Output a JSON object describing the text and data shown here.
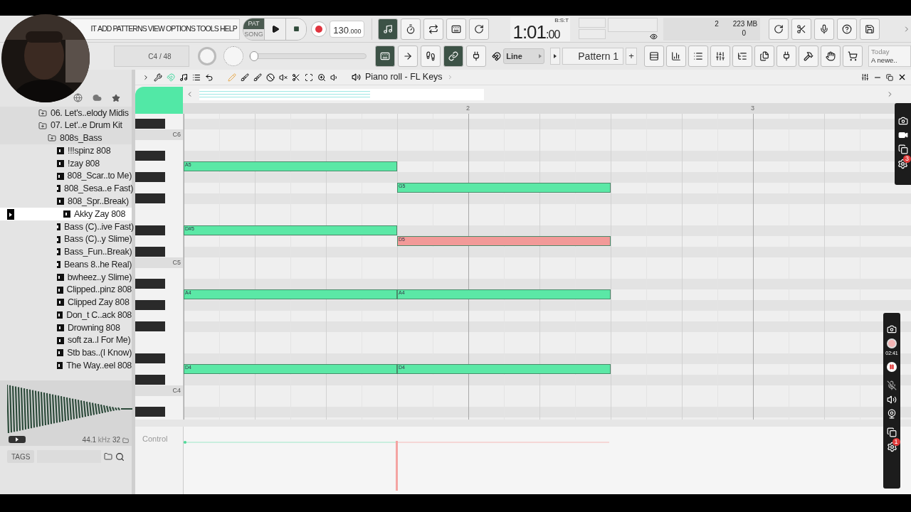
{
  "menu": [
    "IT",
    "ADD",
    "PATTERNS",
    "VIEW",
    "OPTIONS",
    "TOOLS",
    "HELP"
  ],
  "transport": {
    "modes": [
      {
        "label": "PAT",
        "selected": true
      },
      {
        "label": "SONG",
        "selected": false
      }
    ],
    "tempo": "130",
    "tempo_fraction": ".000"
  },
  "time": {
    "main": "1:01",
    "sub": ":00",
    "format": "B:S:T"
  },
  "cpu": {
    "voices": "2",
    "memory": "223 MB",
    "polyphony": "0"
  },
  "hint": "C4 / 48",
  "main_slider": {
    "level": 0
  },
  "snap": "Line",
  "pattern": "Pattern 1",
  "add_pattern": "+",
  "news": {
    "line1": "Today",
    "line2": "A newe.."
  },
  "browser": {
    "tree": [
      {
        "label": "06. Let's..elody Midis",
        "kind": "folder",
        "selected": false
      },
      {
        "label": "07. Let'..e Drum Kit",
        "kind": "folder",
        "selected": false,
        "children": [
          {
            "label": "808s_Bass",
            "kind": "folder",
            "selected": false,
            "children": [
              {
                "label": "!!!spinz 808",
                "kind": "file",
                "selected": false
              },
              {
                "label": "!zay 808",
                "kind": "file",
                "selected": false
              },
              {
                "label": "808_Scar..to Me)",
                "kind": "file",
                "selected": false
              },
              {
                "label": "808_Sesa..e Fast)",
                "kind": "file",
                "selected": false
              },
              {
                "label": "808_Spr..Break)",
                "kind": "file",
                "selected": false
              },
              {
                "label": "Akky Zay 808",
                "kind": "file",
                "selected": true
              },
              {
                "label": "Bass (C)..ive Fast)",
                "kind": "file",
                "selected": false
              },
              {
                "label": "Bass (C)..y Slime)",
                "kind": "file",
                "selected": false
              },
              {
                "label": "Bass_Fun..Break)",
                "kind": "file",
                "selected": false
              },
              {
                "label": "Beans 8..he Real)",
                "kind": "file",
                "selected": false
              },
              {
                "label": "bwheez..y Slime)",
                "kind": "file",
                "selected": false
              },
              {
                "label": "Clipped..pinz 808",
                "kind": "file",
                "selected": false
              },
              {
                "label": "Clipped Zay 808",
                "kind": "file",
                "selected": false
              },
              {
                "label": "Don_t C..ack 808",
                "kind": "file",
                "selected": false
              },
              {
                "label": "Drowning 808",
                "kind": "file",
                "selected": false
              },
              {
                "label": "soft za..l For Me)",
                "kind": "file",
                "selected": false
              },
              {
                "label": "Stb bas..(I Know)",
                "kind": "file",
                "selected": false
              },
              {
                "label": "The Way..eel 808",
                "kind": "file",
                "selected": false
              }
            ]
          }
        ]
      }
    ],
    "sample_rate": "44.1",
    "sample_unit": "kHz",
    "bit_depth": "32",
    "tags_label": "TAGS"
  },
  "piano_roll": {
    "title": "Piano roll - FL Keys",
    "ruler": [
      "2",
      "3"
    ],
    "key_labels": [
      "C6",
      "C5",
      "C4"
    ],
    "note_columns": [
      {
        "notes": [
          {
            "label": "A5",
            "color": "#5be8a6"
          },
          {
            "label": "D#5",
            "color": "#5be8a6"
          },
          {
            "label": "A4",
            "color": "#5be8a6"
          },
          {
            "label": "D4",
            "color": "#5be8a6"
          }
        ]
      },
      {
        "notes": [
          {
            "label": "G5",
            "color": "#5be8a6"
          },
          {
            "label": "D5",
            "color": "#f29a98"
          },
          {
            "label": "A4",
            "color": "#5be8a6"
          },
          {
            "label": "D4",
            "color": "#5be8a6"
          }
        ]
      }
    ],
    "control_label": "Control"
  },
  "recorder": {
    "timer": "02:41",
    "top_badge": "3",
    "bottom_badge": "1"
  }
}
